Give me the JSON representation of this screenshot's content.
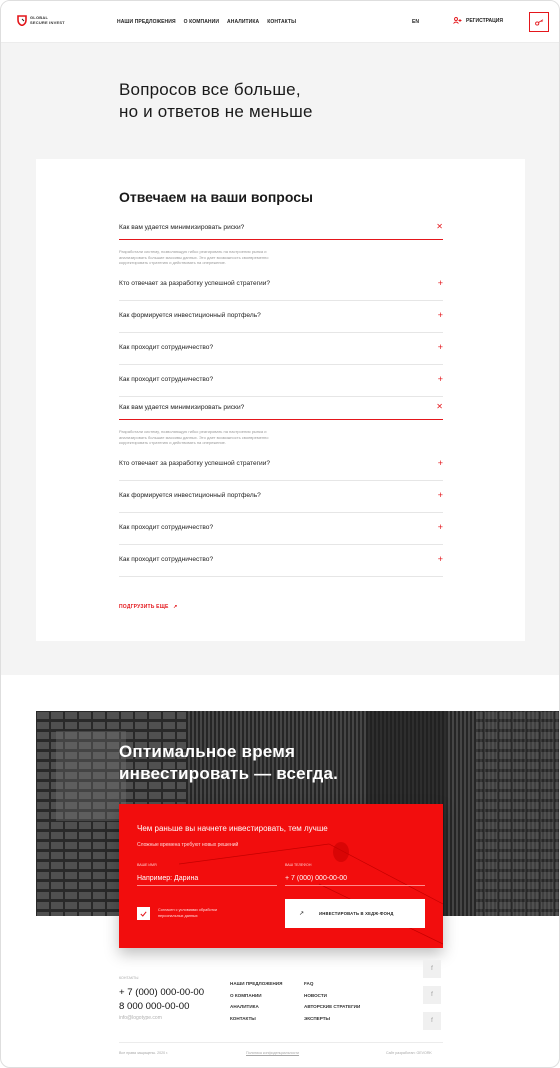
{
  "header": {
    "logo_line1": "GLOBAL",
    "logo_line2": "SECURE INVEST",
    "nav": [
      "НАШИ ПРЕДЛОЖЕНИЯ",
      "О КОМПАНИИ",
      "АНАЛИТИКА",
      "КОНТАКТЫ"
    ],
    "lang": "EN",
    "register": "РЕГИСТРАЦИЯ",
    "accent_color": "#e4161b"
  },
  "hero": {
    "title_line1": "Вопросов все больше,",
    "title_line2": "но и ответов не меньше"
  },
  "faq": {
    "title": "Отвечаем на ваши вопросы",
    "answer_text": "Разработали систему, позволяющую гибко реагировать на настроения рынка и анализировать большие массивы данных. Это дает возможность своевременно корректировать стратегию и действовать на опережение.",
    "items": [
      {
        "q": "Как вам удается минимизировать риски?",
        "open": true
      },
      {
        "q": "Кто отвечает за разработку успешной стратегии?",
        "open": false
      },
      {
        "q": "Как формируется инвестиционный портфель?",
        "open": false
      },
      {
        "q": "Как проходит сотрудничество?",
        "open": false
      },
      {
        "q": "Как проходит сотрудничество?",
        "open": false
      },
      {
        "q": "Как вам удается минимизировать риски?",
        "open": true
      },
      {
        "q": "Кто отвечает за разработку успешной стратегии?",
        "open": false
      },
      {
        "q": "Как формируется инвестиционный портфель?",
        "open": false
      },
      {
        "q": "Как проходит сотрудничество?",
        "open": false
      },
      {
        "q": "Как проходит сотрудничество?",
        "open": false
      }
    ],
    "load_more": "ПОДГРУЗИТЬ ЕЩЕ"
  },
  "promo": {
    "title_line1": "Оптимальное время",
    "title_line2": "инвестировать — всегда."
  },
  "form": {
    "title": "Чем раньше вы начнете инвестировать, тем лучше",
    "subtitle": "Сложные времена требуют новых решений",
    "name_label": "ВАШЕ ИМЯ",
    "name_placeholder": "Например: Дарина",
    "phone_label": "ВАШ ТЕЛЕФОН",
    "phone_placeholder": "+ 7 (000) 000-00-00",
    "agree_text": "Согласен с условиями обработки персональных данных",
    "submit": "ИНВЕСТИРОВАТЬ В ХЕДЖ-ФОНД"
  },
  "footer": {
    "contacts_label": "КОНТАКТЫ",
    "phone1": "+ 7 (000) 000-00-00",
    "phone2": "8 000 000-00-00",
    "email": "info@logotype.com",
    "col1": [
      "НАШИ ПРЕДЛОЖЕНИЯ",
      "О КОМПАНИИ",
      "АНАЛИТИКА",
      "КОНТАКТЫ"
    ],
    "col2": [
      "FAQ",
      "НОВОСТИ",
      "АВТОРСКИЕ СТРАТЕГИИ",
      "ЭКСПЕРТЫ"
    ],
    "social_icon": "f",
    "copyright": "Все права защищены. 2020 г.",
    "privacy": "Политика конфиденциальности",
    "developer": "Сайт разработан: GEVORK"
  }
}
